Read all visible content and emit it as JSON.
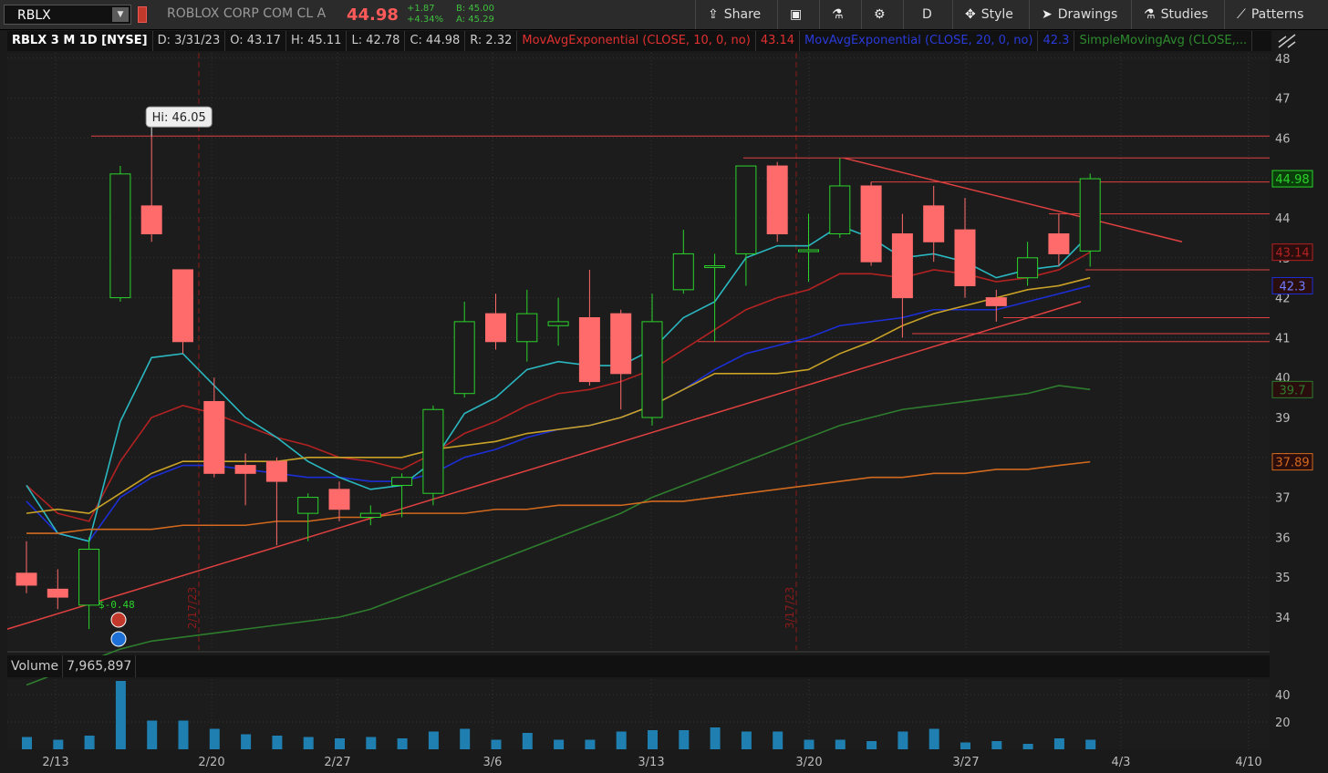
{
  "toolbar": {
    "symbol": "RBLX",
    "company": "ROBLOX CORP COM CL A",
    "last_price": "44.98",
    "net_change": "+1.87",
    "pct_change": "+4.34%",
    "bid": "B: 45.00",
    "ask": "A: 45.29",
    "share_label": "Share",
    "period_label": "D",
    "style_label": "Style",
    "drawings_label": "Drawings",
    "studies_label": "Studies",
    "patterns_label": "Patterns"
  },
  "infobar": {
    "symbol": "RBLX 3 M 1D [NYSE]",
    "date": "D: 3/31/23",
    "open": "O: 43.17",
    "high": "H: 45.11",
    "low": "L: 42.78",
    "close": "C: 44.98",
    "range": "R: 2.32",
    "ema10_label": "MovAvgExponential (CLOSE, 10, 0, no)",
    "ema10_value": "43.14",
    "ema20_label": "MovAvgExponential (CLOSE, 20, 0, no)",
    "ema20_value": "42.3",
    "sma_label": "SimpleMovingAvg (CLOSE,..."
  },
  "volume_panel": {
    "label": "Volume",
    "value": "7,965,897"
  },
  "colors": {
    "up": "#2bd42b",
    "down": "#ff6b6b",
    "ema10": "#b22222",
    "ema20": "#1c2fd6",
    "ema_cyan": "#2ab7c0",
    "ma_gold": "#c9a227",
    "ma_green": "#2e7d2e",
    "ma_orange": "#d2691e",
    "level": "#e04040",
    "volume": "#1e7fb0"
  },
  "chart_data": {
    "type": "candlestick",
    "y_ticks": [
      34,
      35,
      36,
      37,
      38,
      39,
      40,
      41,
      42,
      43,
      44,
      45,
      46,
      47,
      48
    ],
    "x_ticks": [
      "2/13",
      "2/20",
      "2/27",
      "3/6",
      "3/13",
      "3/20",
      "3/27",
      "4/3",
      "4/10"
    ],
    "volume_ticks": [
      20,
      40
    ],
    "candles": [
      {
        "o": 35.1,
        "h": 35.9,
        "l": 34.6,
        "c": 34.8
      },
      {
        "o": 34.7,
        "h": 35.2,
        "l": 34.2,
        "c": 34.5
      },
      {
        "o": 34.3,
        "h": 36.0,
        "l": 33.7,
        "c": 35.7
      },
      {
        "o": 42.0,
        "h": 45.3,
        "l": 41.9,
        "c": 45.1
      },
      {
        "o": 44.3,
        "h": 46.05,
        "l": 43.4,
        "c": 43.6
      },
      {
        "o": 42.7,
        "h": 42.7,
        "l": 40.6,
        "c": 40.9
      },
      {
        "o": 39.4,
        "h": 40.0,
        "l": 37.5,
        "c": 37.6
      },
      {
        "o": 37.8,
        "h": 38.1,
        "l": 36.8,
        "c": 37.6
      },
      {
        "o": 37.9,
        "h": 38.0,
        "l": 35.8,
        "c": 37.4
      },
      {
        "o": 36.6,
        "h": 37.1,
        "l": 35.9,
        "c": 37.0
      },
      {
        "o": 37.2,
        "h": 37.4,
        "l": 36.4,
        "c": 36.7
      },
      {
        "o": 36.5,
        "h": 36.8,
        "l": 36.3,
        "c": 36.6
      },
      {
        "o": 37.3,
        "h": 37.6,
        "l": 36.5,
        "c": 37.5
      },
      {
        "o": 37.1,
        "h": 39.3,
        "l": 36.8,
        "c": 39.2
      },
      {
        "o": 39.6,
        "h": 41.9,
        "l": 39.5,
        "c": 41.4
      },
      {
        "o": 41.6,
        "h": 42.1,
        "l": 40.7,
        "c": 40.9
      },
      {
        "o": 40.9,
        "h": 42.2,
        "l": 40.4,
        "c": 41.6
      },
      {
        "o": 41.3,
        "h": 42.0,
        "l": 40.8,
        "c": 41.4
      },
      {
        "o": 41.5,
        "h": 42.7,
        "l": 39.8,
        "c": 39.9
      },
      {
        "o": 41.6,
        "h": 41.7,
        "l": 39.2,
        "c": 40.1
      },
      {
        "o": 39.0,
        "h": 42.1,
        "l": 38.8,
        "c": 41.4
      },
      {
        "o": 42.2,
        "h": 43.7,
        "l": 42.1,
        "c": 43.1
      },
      {
        "o": 42.8,
        "h": 43.1,
        "l": 40.9,
        "c": 42.8
      },
      {
        "o": 43.1,
        "h": 45.3,
        "l": 42.3,
        "c": 45.3
      },
      {
        "o": 45.3,
        "h": 45.4,
        "l": 43.4,
        "c": 43.6
      },
      {
        "o": 43.2,
        "h": 44.1,
        "l": 42.4,
        "c": 43.2
      },
      {
        "o": 43.6,
        "h": 45.5,
        "l": 43.5,
        "c": 44.8
      },
      {
        "o": 44.8,
        "h": 44.9,
        "l": 42.8,
        "c": 42.9
      },
      {
        "o": 43.6,
        "h": 44.1,
        "l": 41.0,
        "c": 42.0
      },
      {
        "o": 44.3,
        "h": 44.8,
        "l": 42.9,
        "c": 43.4
      },
      {
        "o": 43.7,
        "h": 44.5,
        "l": 42.0,
        "c": 42.3
      },
      {
        "o": 42.0,
        "h": 42.2,
        "l": 41.4,
        "c": 41.8
      },
      {
        "o": 42.5,
        "h": 43.4,
        "l": 42.3,
        "c": 43.0
      },
      {
        "o": 43.6,
        "h": 44.1,
        "l": 42.8,
        "c": 43.1
      },
      {
        "o": 43.17,
        "h": 45.11,
        "l": 42.78,
        "c": 44.98
      }
    ],
    "volume": [
      9,
      7,
      10,
      50,
      21,
      21,
      15,
      11,
      10,
      9,
      8,
      9,
      8,
      13,
      15,
      7,
      12,
      7,
      7,
      13,
      14,
      14,
      16,
      13,
      13,
      7,
      7,
      6,
      13,
      15,
      5,
      6,
      4,
      8,
      7
    ],
    "studies": [
      {
        "name": "MovAvgExponential (CLOSE, 10, 0, no)",
        "color": "#b22222",
        "values": [
          37.3,
          36.6,
          36.4,
          37.9,
          39.0,
          39.3,
          39.1,
          38.8,
          38.5,
          38.3,
          38.0,
          37.9,
          37.7,
          38.1,
          38.6,
          38.9,
          39.3,
          39.6,
          39.7,
          39.9,
          40.2,
          40.7,
          41.2,
          41.7,
          42.0,
          42.2,
          42.6,
          42.6,
          42.5,
          42.7,
          42.6,
          42.4,
          42.5,
          42.7,
          43.14
        ]
      },
      {
        "name": "MovAvgExponential (CLOSE, 20, 0, no)",
        "color": "#1c2fd6",
        "values": [
          36.9,
          36.1,
          35.9,
          37.0,
          37.5,
          37.8,
          37.8,
          37.7,
          37.6,
          37.5,
          37.5,
          37.4,
          37.4,
          37.6,
          38.0,
          38.2,
          38.5,
          38.7,
          38.8,
          39.0,
          39.3,
          39.7,
          40.2,
          40.6,
          40.8,
          41.0,
          41.3,
          41.4,
          41.5,
          41.7,
          41.7,
          41.7,
          41.9,
          42.1,
          42.3
        ]
      },
      {
        "name": "EMA cyan",
        "color": "#2ab7c0",
        "values": [
          37.3,
          36.1,
          35.9,
          38.9,
          40.5,
          40.6,
          39.8,
          39.0,
          38.5,
          37.9,
          37.5,
          37.2,
          37.3,
          37.9,
          39.1,
          39.5,
          40.2,
          40.4,
          40.3,
          40.3,
          40.7,
          41.5,
          41.9,
          43.0,
          43.3,
          43.3,
          43.8,
          43.5,
          43.0,
          43.1,
          42.9,
          42.5,
          42.7,
          42.8,
          43.6
        ]
      },
      {
        "name": "MA gold",
        "color": "#c9a227",
        "values": [
          36.6,
          36.7,
          36.6,
          37.1,
          37.6,
          37.9,
          37.9,
          37.9,
          37.9,
          38.0,
          38.0,
          38.0,
          38.0,
          38.2,
          38.3,
          38.4,
          38.6,
          38.7,
          38.8,
          39.0,
          39.3,
          39.7,
          40.1,
          40.1,
          40.1,
          40.2,
          40.6,
          40.9,
          41.3,
          41.6,
          41.8,
          42.0,
          42.2,
          42.3,
          42.5
        ]
      },
      {
        "name": "MA green",
        "color": "#2e7d2e",
        "values": [
          32.3,
          32.6,
          32.9,
          33.2,
          33.4,
          33.5,
          33.6,
          33.7,
          33.8,
          33.9,
          34.0,
          34.2,
          34.5,
          34.8,
          35.1,
          35.4,
          35.7,
          36.0,
          36.3,
          36.6,
          37.0,
          37.3,
          37.6,
          37.9,
          38.2,
          38.5,
          38.8,
          39.0,
          39.2,
          39.3,
          39.4,
          39.5,
          39.6,
          39.8,
          39.7
        ]
      },
      {
        "name": "MA orange",
        "color": "#d2691e",
        "values": [
          36.1,
          36.1,
          36.2,
          36.2,
          36.2,
          36.3,
          36.3,
          36.3,
          36.4,
          36.4,
          36.5,
          36.5,
          36.6,
          36.6,
          36.6,
          36.7,
          36.7,
          36.8,
          36.8,
          36.8,
          36.9,
          36.9,
          37.0,
          37.1,
          37.2,
          37.3,
          37.4,
          37.5,
          37.5,
          37.6,
          37.6,
          37.7,
          37.7,
          37.8,
          37.89
        ]
      }
    ],
    "levels": [
      46.05,
      45.5,
      44.9,
      44.1,
      42.7,
      41.5,
      41.1,
      40.9
    ],
    "annotations": {
      "hi_label": "Hi: 46.05",
      "earnings_label": "$-0.48",
      "vline_feb": "2/17/23",
      "vline_mar": "3/17/23"
    },
    "price_labels": [
      {
        "text": "44.98",
        "value": 44.98,
        "color": "#2bd42b"
      },
      {
        "text": "43.14",
        "value": 43.14,
        "color": "#b22222"
      },
      {
        "text": "42.3",
        "value": 42.3,
        "color": "#1c2fd6"
      },
      {
        "text": "39.7",
        "value": 39.7,
        "color": "#2e7d2e"
      },
      {
        "text": "37.89",
        "value": 37.89,
        "color": "#d2691e"
      }
    ]
  }
}
